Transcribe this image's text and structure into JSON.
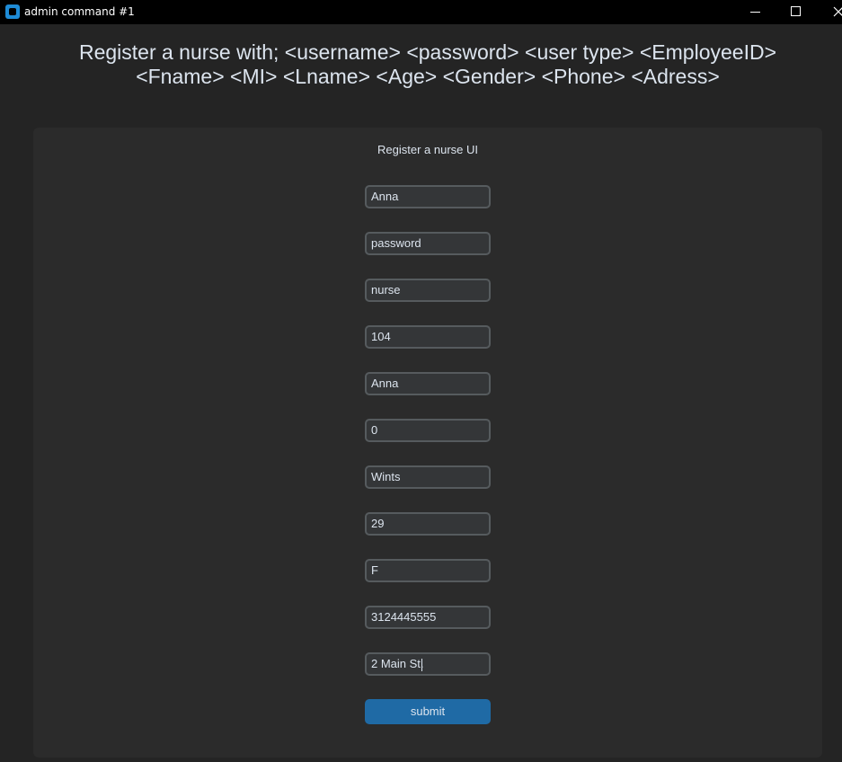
{
  "window": {
    "title": "admin command #1",
    "controls": {
      "minimize_icon": "minimize-icon",
      "maximize_icon": "maximize-icon",
      "close_icon": "close-icon"
    }
  },
  "heading": {
    "line1": "Register a nurse with; <username> <password> <user type> <EmployeeID>",
    "line2": "<Fname> <MI> <Lname> <Age> <Gender> <Phone> <Adress>"
  },
  "form": {
    "title": "Register a nurse UI",
    "fields": [
      {
        "name": "username",
        "value": "Anna"
      },
      {
        "name": "password",
        "value": "password"
      },
      {
        "name": "user-type",
        "value": "nurse"
      },
      {
        "name": "employee-id",
        "value": "104"
      },
      {
        "name": "fname",
        "value": "Anna"
      },
      {
        "name": "mi",
        "value": "0"
      },
      {
        "name": "lname",
        "value": "Wints"
      },
      {
        "name": "age",
        "value": "29"
      },
      {
        "name": "gender",
        "value": "F"
      },
      {
        "name": "phone",
        "value": "3124445555"
      },
      {
        "name": "address",
        "value": "2 Main St."
      }
    ],
    "submit_label": "submit"
  },
  "colors": {
    "background": "#242424",
    "panel": "#2b2b2b",
    "entry_bg": "#343638",
    "entry_border": "#565b5e",
    "text": "#dce4ee",
    "button": "#1f6aa5",
    "titlebar": "#000000",
    "app_icon": "#1e8bd6"
  }
}
